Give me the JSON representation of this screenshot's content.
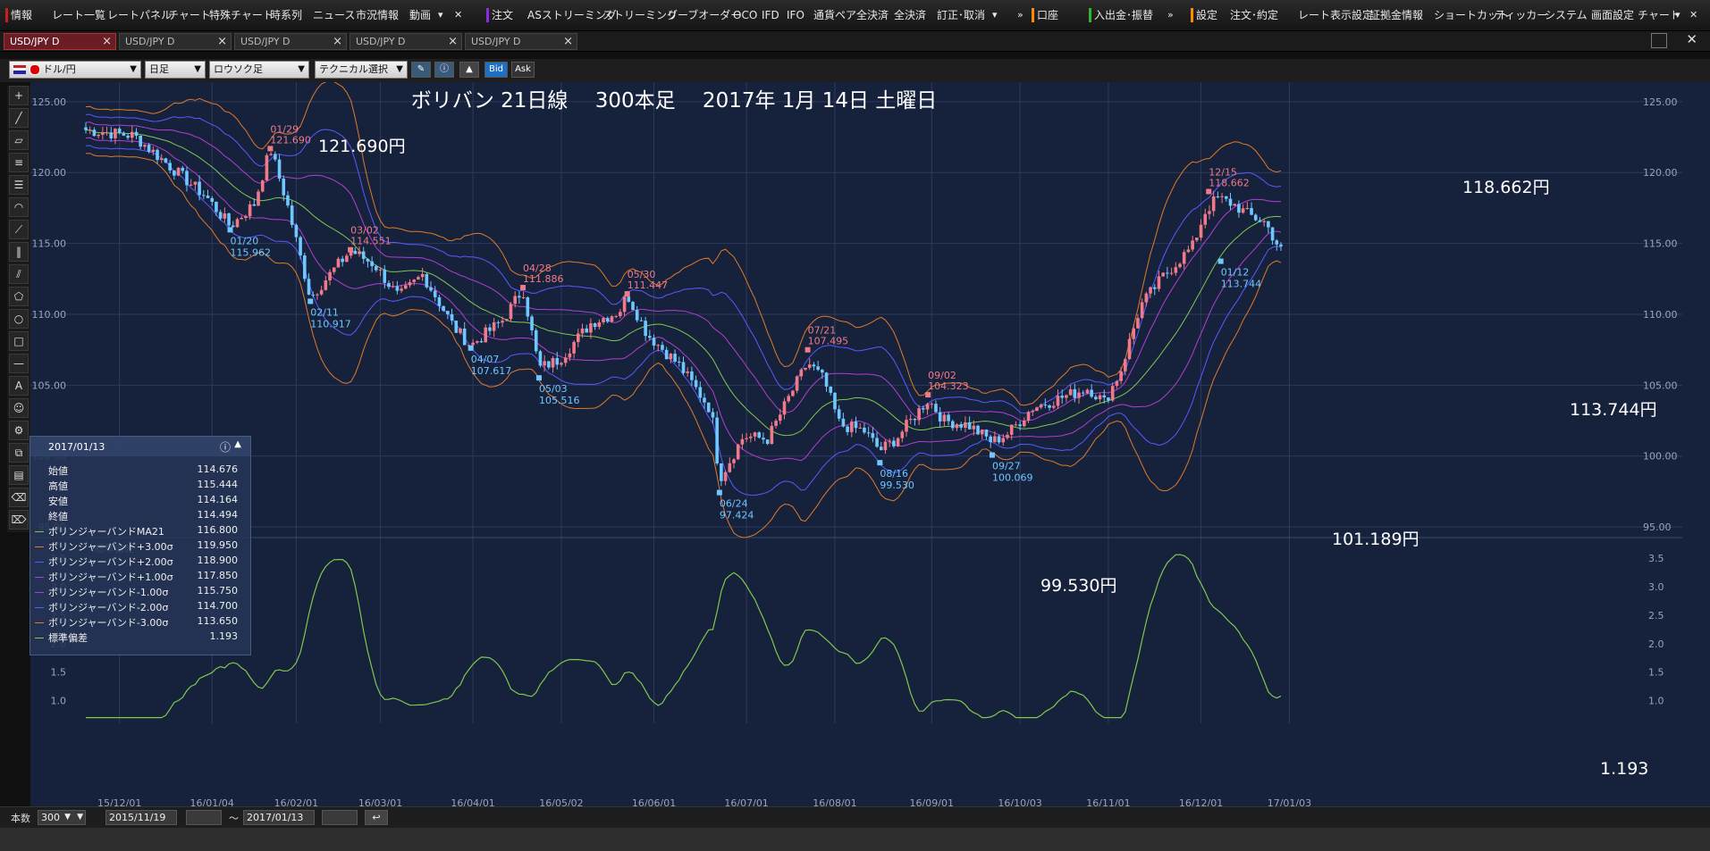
{
  "menubar": {
    "items": [
      {
        "label": "情報",
        "marker": "#c81e1e"
      },
      {
        "label": "レート一覧"
      },
      {
        "label": "レートパネル"
      },
      {
        "label": "チャート"
      },
      {
        "label": "特殊チャート"
      },
      {
        "label": "時系列"
      },
      {
        "label": "ニュース"
      },
      {
        "label": "市況情報"
      },
      {
        "label": "動画"
      },
      {
        "label": "注文",
        "marker": "#8a2be2"
      },
      {
        "label": "ASストリーミング"
      },
      {
        "label": "ストリーミング"
      },
      {
        "label": "リーブオーダー"
      },
      {
        "label": "OCO"
      },
      {
        "label": "IFD"
      },
      {
        "label": "IFO"
      },
      {
        "label": "通貨ペア全決済"
      },
      {
        "label": "全決済"
      },
      {
        "label": "訂正･取消"
      },
      {
        "label": "口座",
        "marker": "#ff8c00"
      },
      {
        "label": "入出金･振替",
        "marker": "#2eb82e"
      },
      {
        "label": "設定",
        "marker": "#ff8c00"
      },
      {
        "label": "注文･約定"
      },
      {
        "label": "レート表示設定"
      },
      {
        "label": "証拠金情報"
      },
      {
        "label": "ショートカット"
      },
      {
        "label": "ティッカー"
      },
      {
        "label": "システム"
      },
      {
        "label": "画面設定"
      },
      {
        "label": "チャート"
      }
    ]
  },
  "tabs": [
    {
      "label": "USD/JPY D",
      "active": true
    },
    {
      "label": "USD/JPY D",
      "active": false
    },
    {
      "label": "USD/JPY D",
      "active": false
    },
    {
      "label": "USD/JPY D",
      "active": false
    },
    {
      "label": "USD/JPY D",
      "active": false
    }
  ],
  "toolbar": {
    "currency_pair": "ドル/円",
    "period": "日足",
    "chart_style": "ロウソク足",
    "technical_select": "テクニカル選択",
    "bid_label": "Bid",
    "ask_label": "Ask"
  },
  "chart_data": [
    {
      "type": "candlestick",
      "title": "ボリバン 21日線　 300本足　 2017年 1月 14日 土曜日",
      "instrument": "USD/JPY",
      "ylim": [
        94.5,
        126
      ],
      "y_ticks": [
        "125.00",
        "120.00",
        "115.00",
        "110.00",
        "105.00",
        "100.00",
        "95.00"
      ],
      "x_ticks": [
        "15/12/01",
        "16/01/04",
        "16/02/01",
        "16/03/01",
        "16/04/01",
        "16/05/02",
        "16/06/01",
        "16/07/01",
        "16/08/01",
        "16/09/01",
        "16/10/03",
        "16/11/01",
        "16/12/01",
        "17/01/03"
      ],
      "series_colors": {
        "ma21": "#7ec850",
        "sigma1": "#b040d0",
        "sigma2": "#5a5aff",
        "sigma3": "#e07a28",
        "up": "#f07a8a",
        "down": "#6ec8ff"
      },
      "highs": [
        {
          "date": "01/29",
          "value": "121.690"
        },
        {
          "date": "03/02",
          "value": "114.551"
        },
        {
          "date": "04/28",
          "value": "111.886"
        },
        {
          "date": "05/30",
          "value": "111.447"
        },
        {
          "date": "07/21",
          "value": "107.495"
        },
        {
          "date": "09/02",
          "value": "104.323"
        },
        {
          "date": "12/15",
          "value": "118.662"
        }
      ],
      "lows": [
        {
          "date": "01/20",
          "value": "115.962"
        },
        {
          "date": "02/11",
          "value": "110.917"
        },
        {
          "date": "04/07",
          "value": "107.617"
        },
        {
          "date": "05/03",
          "value": "105.516"
        },
        {
          "date": "06/24",
          "value": "97.424"
        },
        {
          "date": "08/16",
          "value": "99.530"
        },
        {
          "date": "09/27",
          "value": "100.069"
        },
        {
          "date": "01/12",
          "value": "113.744"
        }
      ],
      "annotations": [
        "121.690円",
        "118.662円",
        "113.744円",
        "101.189円",
        "99.530円"
      ]
    },
    {
      "type": "line",
      "title": "標準偏差",
      "ylim": [
        0.6,
        3.8
      ],
      "y_ticks": [
        "3.5",
        "3.0",
        "2.5",
        "2.0",
        "1.5",
        "1.0"
      ],
      "annotation": "1.193"
    }
  ],
  "infopanel": {
    "date": "2017/01/13",
    "rows": [
      {
        "label": "始値",
        "value": "114.676"
      },
      {
        "label": "高値",
        "value": "115.444"
      },
      {
        "label": "安値",
        "value": "114.164"
      },
      {
        "label": "終値",
        "value": "114.494"
      },
      {
        "label": "ボリンジャーバンドMA21",
        "value": "116.800",
        "color": "#7ec850"
      },
      {
        "label": "ボリンジャーバンド+3.00σ",
        "value": "119.950",
        "color": "#e07a28"
      },
      {
        "label": "ボリンジャーバンド+2.00σ",
        "value": "118.900",
        "color": "#5a5aff"
      },
      {
        "label": "ボリンジャーバンド+1.00σ",
        "value": "117.850",
        "color": "#b040d0"
      },
      {
        "label": "ボリンジャーバンド-1.00σ",
        "value": "115.750",
        "color": "#b040d0"
      },
      {
        "label": "ボリンジャーバンド-2.00σ",
        "value": "114.700",
        "color": "#5a5aff"
      },
      {
        "label": "ボリンジャーバンド-3.00σ",
        "value": "113.650",
        "color": "#e07a28"
      },
      {
        "label": "標準偏差",
        "value": "1.193",
        "color": "#7ec850"
      }
    ]
  },
  "bottombar": {
    "count_label": "本数",
    "count_value": "300",
    "from_date": "2015/11/19",
    "tilde": "～",
    "to_date": "2017/01/13"
  }
}
